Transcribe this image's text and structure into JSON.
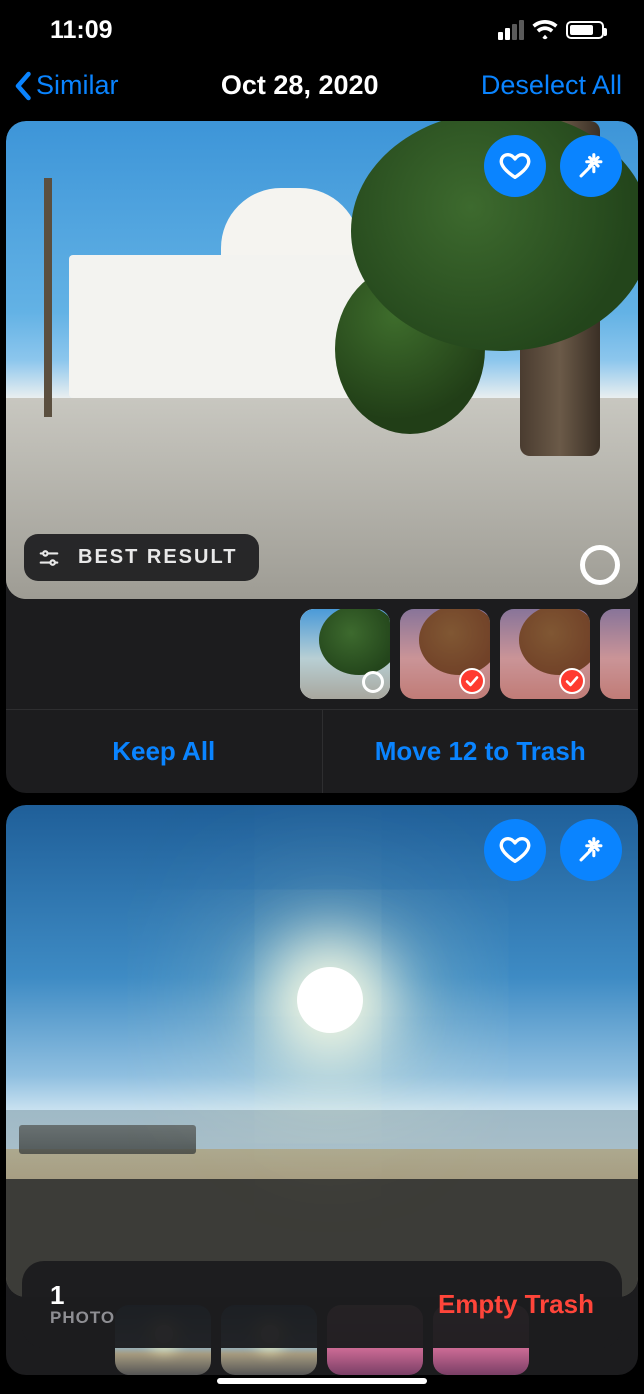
{
  "status": {
    "time": "11:09"
  },
  "nav": {
    "back_label": "Similar",
    "title": "Oct 28, 2020",
    "action_label": "Deselect All"
  },
  "card1": {
    "best_result_label": "BEST RESULT",
    "keep_all_label": "Keep All",
    "move_trash_label": "Move 12 to Trash"
  },
  "trash": {
    "count": "1",
    "label": "PHOTO",
    "action": "Empty Trash"
  }
}
